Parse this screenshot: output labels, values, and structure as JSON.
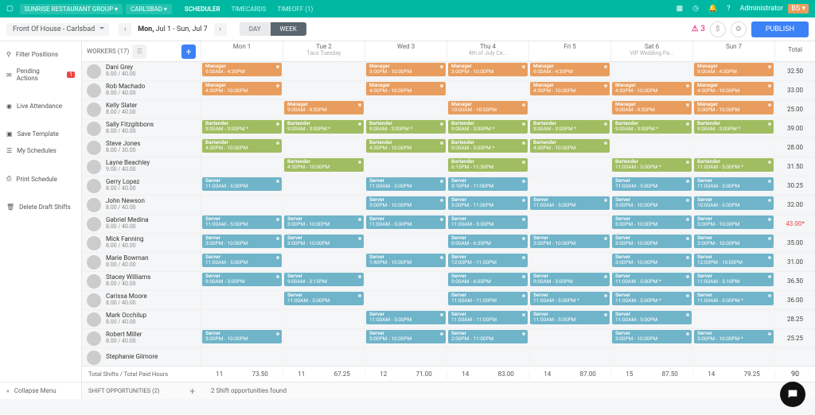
{
  "topbar": {
    "org": "SUNRISE RESTAURANT GROUP",
    "location": "CARLSBAD",
    "tabs": {
      "scheduler": "SCHEDULER",
      "timecards": "TIMECARDS",
      "timeoff": "TIMEOFF (1)"
    },
    "user": "Administrator"
  },
  "subbar": {
    "department": "Front Of House - Carlsbad",
    "daterange_a": "Mon, ",
    "daterange_b": "Jul 1 - Sun, ",
    "daterange_c": "Jul 7",
    "view_day": "DAY",
    "view_week": "WEEK",
    "pinkcount": "3",
    "publish": "PUBLISH"
  },
  "left": {
    "filter": "Filter Positions",
    "pending": "Pending Actions",
    "pending_count": "1",
    "live": "Live Attendance",
    "save": "Save Template",
    "mysched": "My Schedules",
    "print": "Print Schedule",
    "delete": "Delete Draft Shifts",
    "collapse": "Collapse Menu"
  },
  "head": {
    "workers": "WORKERS (17)",
    "days": [
      {
        "d": "Mon 1",
        "s": ""
      },
      {
        "d": "Tue 2",
        "s": "Taco Tuesday"
      },
      {
        "d": "Wed 3",
        "s": ""
      },
      {
        "d": "Thu 4",
        "s": "4th of July Ce..."
      },
      {
        "d": "Fri 5",
        "s": ""
      },
      {
        "d": "Sat 6",
        "s": "VIP Wedding Pa..."
      },
      {
        "d": "Sun 7",
        "s": ""
      }
    ],
    "total": "Total"
  },
  "roles": {
    "Manager": "c-orange",
    "Bartender": "c-green",
    "Server": "c-blue",
    "Host": "c-purple"
  },
  "workers": [
    {
      "name": "Dani Grey",
      "hours": "8.00 / 40.00",
      "total": "32.50",
      "shifts": {
        "0": [
          [
            "Manager",
            "9:00AM - 4:30PM"
          ]
        ],
        "2": [
          [
            "Manager",
            "3:00PM - 10:00PM"
          ]
        ],
        "3": [
          [
            "Manager",
            "3:00PM - 10:00PM"
          ]
        ],
        "4": [
          [
            "Manager",
            "9:00AM - 4:30PM"
          ]
        ],
        "6": [
          [
            "Manager",
            "9:00AM - 4:30PM"
          ]
        ]
      }
    },
    {
      "name": "Rob Machado",
      "hours": "8.00 / 40.00",
      "total": "33.00",
      "shifts": {
        "0": [
          [
            "Manager",
            "4:30PM - 10:00PM"
          ]
        ],
        "2": [
          [
            "Manager",
            "4:30PM - 10:00PM"
          ]
        ],
        "4": [
          [
            "Manager",
            "4:30PM - 10:00PM"
          ]
        ],
        "5": [
          [
            "Manager",
            "4:30PM - 10:00PM"
          ]
        ],
        "6": [
          [
            "Manager",
            "4:30PM - 10:00PM"
          ]
        ]
      }
    },
    {
      "name": "Kelly Slater",
      "hours": "8.00 / 40.00",
      "total": "25.00",
      "shifts": {
        "1": [
          [
            "Manager",
            "9:00AM - 4:30PM"
          ]
        ],
        "3": [
          [
            "Manager",
            "10:00AM - 10:00PM"
          ]
        ],
        "5": [
          [
            "Manager",
            "9:00AM - 4:30PM"
          ]
        ],
        "6": [
          [
            "Manager",
            "3:00PM - 10:00PM"
          ]
        ]
      }
    },
    {
      "name": "Sally Fitzgibbons",
      "hours": "8.00 / 40.00",
      "total": "39.00",
      "shifts": {
        "0": [
          [
            "Bartender",
            "9:00AM - 3:00PM *"
          ]
        ],
        "1": [
          [
            "Bartender",
            "9:00AM - 3:00PM *"
          ]
        ],
        "2": [
          [
            "Bartender",
            "9:00AM - 3:00PM *"
          ]
        ],
        "3": [
          [
            "Bartender",
            "9:00AM - 3:00PM *"
          ]
        ],
        "4": [
          [
            "Bartender",
            "9:00AM - 3:00PM *"
          ]
        ],
        "5": [
          [
            "Bartender",
            "9:00AM - 3:00PM *"
          ]
        ],
        "6": [
          [
            "Bartender",
            "9:00AM - 3:00PM *"
          ]
        ]
      }
    },
    {
      "name": "Steve Jones",
      "hours": "8.00 / 30.00",
      "total": "28.00",
      "shifts": {
        "0": [
          [
            "Bartender",
            "4:30PM - 10:00PM"
          ]
        ],
        "2": [
          [
            "Bartender",
            "4:30PM - 10:00PM"
          ]
        ],
        "3": [
          [
            "Bartender",
            "9:00AM - 3:00PM *"
          ]
        ],
        "4": [
          [
            "Bartender",
            "4:30PM - 10:00PM"
          ]
        ]
      }
    },
    {
      "name": "Layne Beachley",
      "hours": "9.00 / 40.00",
      "total": "31.50",
      "shifts": {
        "1": [
          [
            "Bartender",
            "4:30PM - 10:00PM"
          ]
        ],
        "3": [
          [
            "Bartender",
            "6:15PM - 11:30PM"
          ]
        ],
        "5": [
          [
            "Bartender",
            "11:00AM - 5:00PM *"
          ]
        ],
        "6": [
          [
            "Bartender",
            "11:00AM - 5:00PM *"
          ]
        ]
      }
    },
    {
      "name": "Gerry Lopez",
      "hours": "8.00 / 40.00",
      "total": "30.25",
      "shifts": {
        "0": [
          [
            "Server",
            "11:00AM - 5:00PM"
          ]
        ],
        "2": [
          [
            "Server",
            "11:00AM - 5:00PM"
          ]
        ],
        "3": [
          [
            "Server",
            "3:10PM - 11:00PM"
          ]
        ],
        "5": [
          [
            "Server",
            "11:00AM - 5:00PM"
          ]
        ],
        "6": [
          [
            "Server",
            "11:00AM - 5:00PM"
          ]
        ]
      }
    },
    {
      "name": "John Newson",
      "hours": "8.00 / 40.00",
      "total": "32.00",
      "shifts": {
        "2": [
          [
            "Server",
            "3:00PM - 10:00PM"
          ]
        ],
        "3": [
          [
            "Server",
            "3:00PM - 11:00PM"
          ]
        ],
        "4": [
          [
            "Server",
            "11:00AM - 5:00PM"
          ]
        ],
        "5": [
          [
            "Server",
            "3:00PM - 10:00PM"
          ]
        ],
        "6": [
          [
            "Server",
            "10:00AM - 5:00PM"
          ]
        ]
      }
    },
    {
      "name": "Gabriel Medina",
      "hours": "8.00 / 40.00",
      "total": "43.00*",
      "alert": true,
      "shifts": {
        "0": [
          [
            "Server",
            "11:00AM - 5:00PM"
          ]
        ],
        "1": [
          [
            "Server",
            "3:00PM - 10:00PM"
          ]
        ],
        "2": [
          [
            "Server",
            "11:00AM - 5:00PM"
          ]
        ],
        "3": [
          [
            "Server",
            "11:00AM - 5:00PM"
          ]
        ],
        "5": [
          [
            "Server",
            "3:00PM - 10:00PM"
          ]
        ],
        "6": [
          [
            "Server",
            "3:00PM - 10:00PM"
          ]
        ]
      }
    },
    {
      "name": "Mick Fanning",
      "hours": "8.00 / 40.00",
      "total": "35.00",
      "shifts": {
        "0": [
          [
            "Server",
            "3:00PM - 10:00PM"
          ]
        ],
        "1": [
          [
            "Server",
            "3:00PM - 10:00PM"
          ]
        ],
        "3": [
          [
            "Server",
            "9:00AM - 6:30PM"
          ]
        ],
        "4": [
          [
            "Server",
            "3:00PM - 10:00PM"
          ]
        ],
        "5": [
          [
            "Server",
            "3:00PM - 10:00PM"
          ]
        ],
        "6": [
          [
            "Server",
            "3:00PM - 10:00PM"
          ]
        ]
      }
    },
    {
      "name": "Marie Bowman",
      "hours": "8.00 / 40.00",
      "total": "31.00",
      "shifts": {
        "0": [
          [
            "Server",
            "11:00AM - 5:00PM"
          ]
        ],
        "2": [
          [
            "Server",
            "1:40PM - 10:00PM"
          ]
        ],
        "3": [
          [
            "Server",
            "12:00PM - 11:00PM"
          ]
        ],
        "5": [
          [
            "Server",
            "3:00PM - 10:00PM"
          ]
        ],
        "6": [
          [
            "Server",
            "12:00PM - 10:00PM"
          ]
        ]
      }
    },
    {
      "name": "Stacey Williams",
      "hours": "8.00 / 40.00",
      "total": "36.50",
      "shifts": {
        "0": [
          [
            "Server",
            "9:00AM - 3:00PM"
          ]
        ],
        "1": [
          [
            "Server",
            "9:00AM - 3:15PM"
          ]
        ],
        "3": [
          [
            "Server",
            "9:00AM - 6:00PM"
          ]
        ],
        "4": [
          [
            "Server",
            "9:00AM - 3:00PM"
          ]
        ],
        "5": [
          [
            "Server",
            "11:00AM - 5:00PM *"
          ]
        ],
        "6": [
          [
            "Server",
            "11:00AM - 5:10PM"
          ]
        ]
      }
    },
    {
      "name": "Carissa Moore",
      "hours": "8.00 / 40.00",
      "total": "36.00",
      "shifts": {
        "1": [
          [
            "Server",
            "11:00AM - 5:00PM"
          ]
        ],
        "3": [
          [
            "Server",
            "11:00AM - 11:00PM"
          ]
        ],
        "4": [
          [
            "Server",
            "11:00AM - 5:00PM *"
          ]
        ],
        "5": [
          [
            "Server",
            "11:00AM - 5:00PM *"
          ]
        ],
        "6": [
          [
            "Server",
            "11:00AM - 5:00PM *"
          ]
        ]
      }
    },
    {
      "name": "Mark Occhilup",
      "hours": "8.00 / 40.00",
      "total": "28.25",
      "shifts": {
        "2": [
          [
            "Server",
            "11:00AM - 5:00PM"
          ]
        ],
        "3": [
          [
            "Server",
            "11:00AM - 11:00PM"
          ]
        ],
        "4": [
          [
            "Server",
            "11:00AM - 5:00PM"
          ]
        ],
        "5": [
          [
            "Server",
            "11:00AM - 5:00PM"
          ]
        ]
      }
    },
    {
      "name": "Robert Miller",
      "hours": "8.00 / 40.00",
      "total": "25.25",
      "shifts": {
        "0": [
          [
            "Server",
            "3:00PM - 10:00PM"
          ]
        ],
        "2": [
          [
            "Server",
            "3:00PM - 10:00PM"
          ]
        ],
        "3": [
          [
            "Server",
            "2:00PM - 11:00PM"
          ]
        ],
        "5": [
          [
            "Server",
            "3:00PM - 10:00PM"
          ]
        ],
        "6": [
          [
            "Server",
            "3:00PM - 10:00PM *"
          ]
        ]
      }
    },
    {
      "name": "Stephanie Gilmore",
      "hours": "",
      "total": "",
      "shifts": {}
    }
  ],
  "footer": {
    "label": "Total Shifts / Total Paid Hours",
    "cells": [
      [
        "11",
        "73.50"
      ],
      [
        "11",
        "67.25"
      ],
      [
        "12",
        "71.00"
      ],
      [
        "14",
        "83.00"
      ],
      [
        "14",
        "87.00"
      ],
      [
        "15",
        "87.50"
      ],
      [
        "14",
        "79.25"
      ],
      [
        "90",
        ""
      ]
    ]
  },
  "shiftopp": {
    "label": "SHIFT OPPORTUNITIES (2)",
    "found": "2 Shift opportunities found"
  }
}
